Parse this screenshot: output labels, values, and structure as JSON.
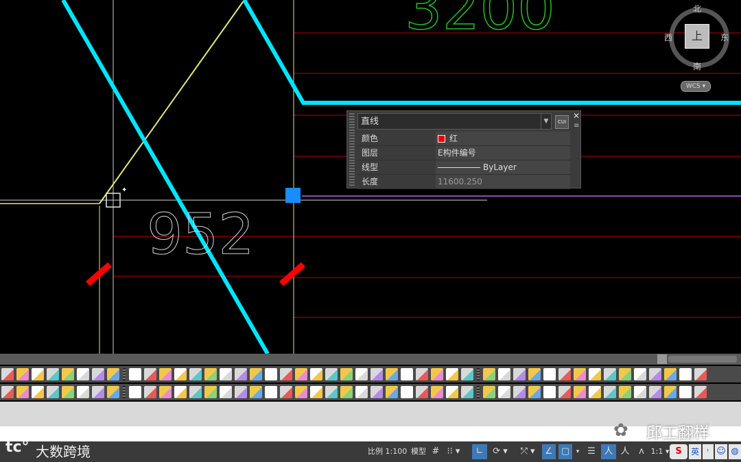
{
  "drawing": {
    "dim_top": "3200",
    "dim_mid": "952"
  },
  "viewcube": {
    "north": "北",
    "south": "南",
    "east": "东",
    "west": "西",
    "face": "上",
    "wcs": "WCS"
  },
  "properties": {
    "object_type": "直线",
    "quick_calc": "CUI",
    "rows": [
      {
        "label": "颜色",
        "value": "红"
      },
      {
        "label": "图层",
        "value": "E构件编号"
      },
      {
        "label": "线型",
        "value": "ByLayer"
      },
      {
        "label": "长度",
        "value": "11600.250"
      }
    ]
  },
  "colors": {
    "cyan_line": "#00e5ff",
    "grip_blue": "#1a8cff",
    "red_layer": "#ff0000",
    "yellow_line": "#e8e87a",
    "green_text": "#22c022"
  },
  "status": {
    "scale": "比例 1:100",
    "model": "模型",
    "annot_scale": "1:1",
    "ime": "英"
  },
  "watermark": {
    "left": "大数跨境",
    "right": "邱工翻样"
  }
}
